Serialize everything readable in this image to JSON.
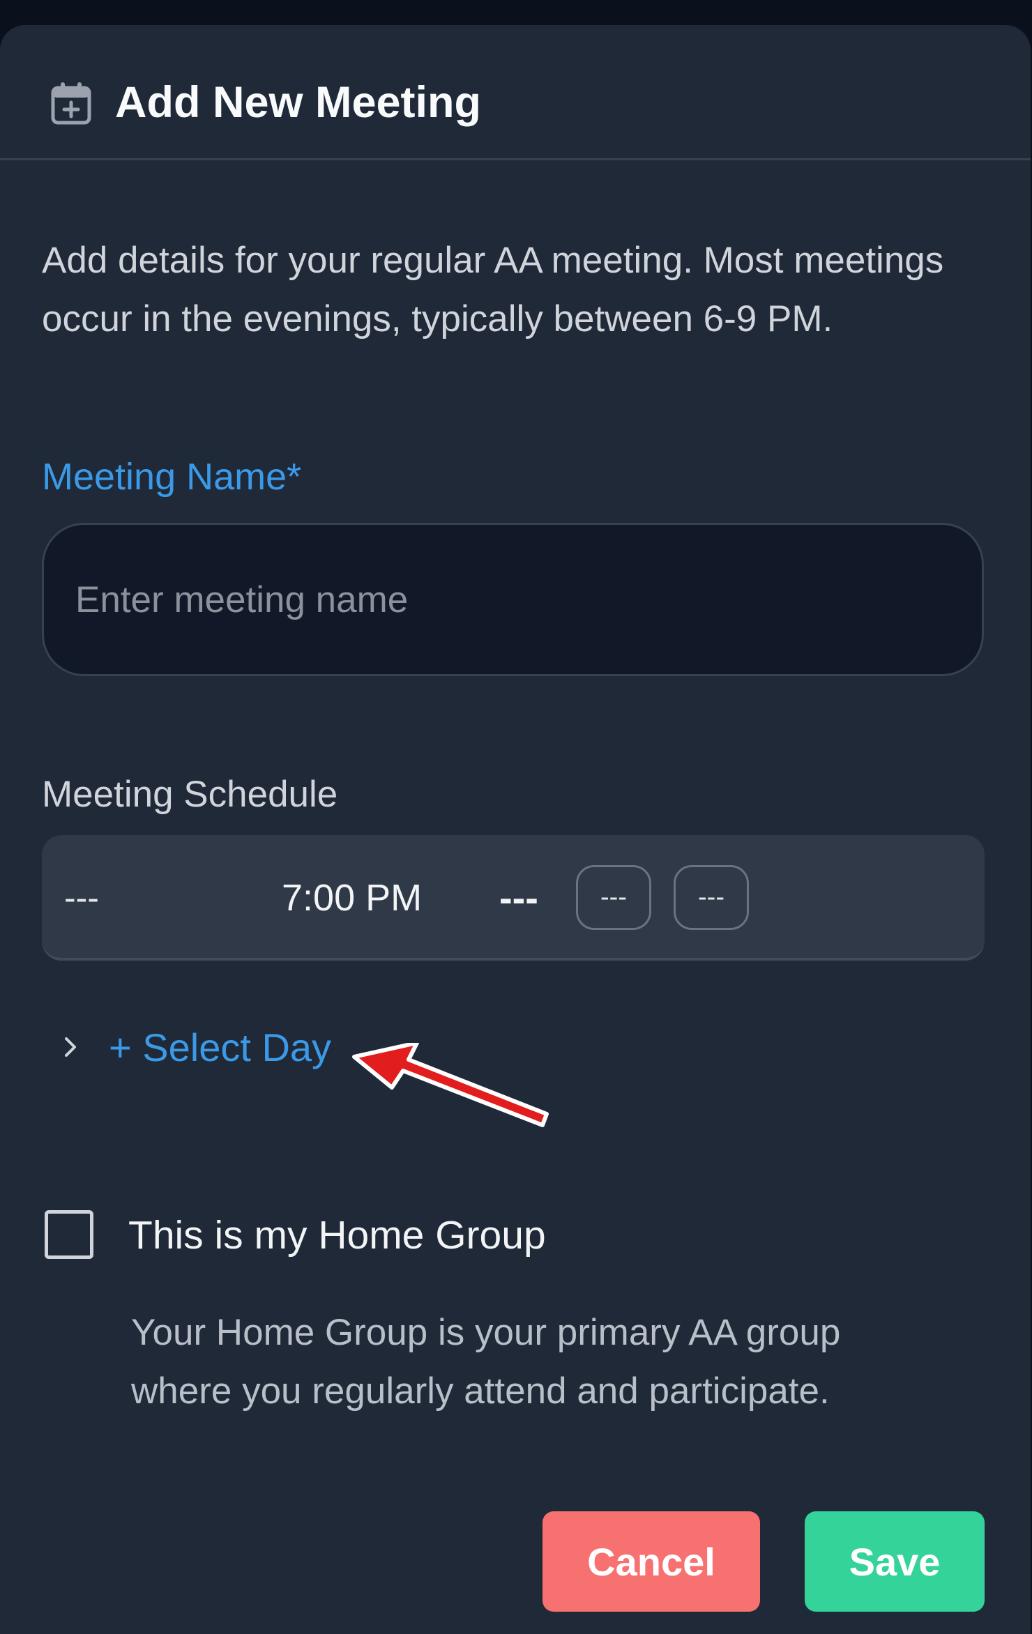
{
  "modal": {
    "title": "Add New Meeting",
    "title_icon": "calendar-plus-icon",
    "description": "Add details for your regular AA meeting. Most meetings occur in the evenings, typically between 6-9 PM."
  },
  "form": {
    "name_label": "Meeting Name*",
    "name_value": "",
    "name_placeholder": "Enter meeting name",
    "schedule_label": "Meeting Schedule",
    "schedule": {
      "day": "---",
      "time": "7:00 PM",
      "bold_dash": "---",
      "pill_1": "---",
      "pill_2": "---"
    },
    "select_day_label": "+ Select Day",
    "home_group": {
      "checked": false,
      "label": "This is my Home Group",
      "help": "Your Home Group is your primary AA group where you regularly attend and participate."
    }
  },
  "actions": {
    "cancel_label": "Cancel",
    "save_label": "Save"
  },
  "colors": {
    "background": "#1f2937",
    "accent": "#3b9ae8",
    "cancel": "#f87171",
    "save": "#34d399",
    "annotation": "#e11d1d"
  }
}
